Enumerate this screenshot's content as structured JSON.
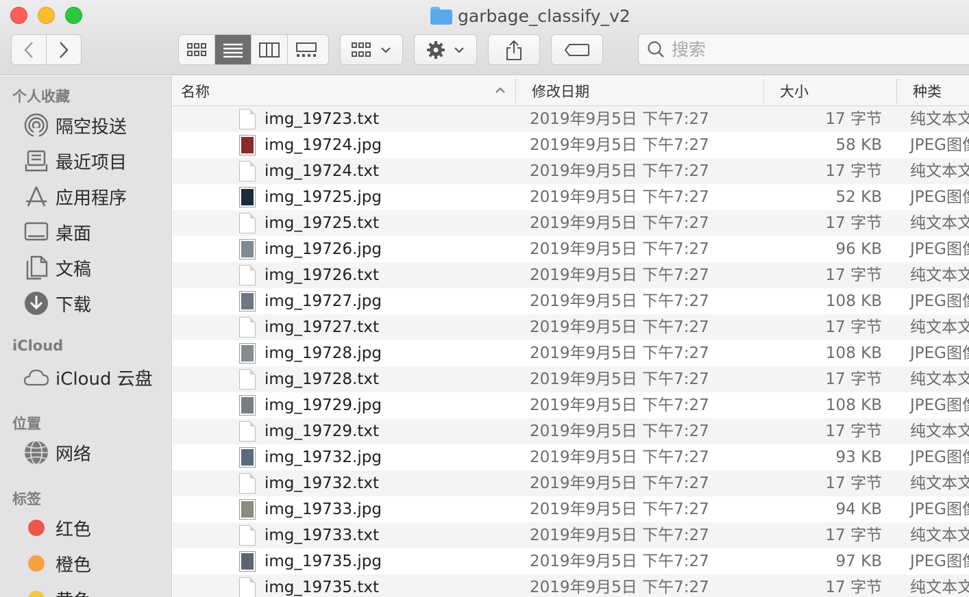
{
  "window": {
    "title": "garbage_classify_v2"
  },
  "toolbar": {
    "search_placeholder": "搜索"
  },
  "sidebar": {
    "sections": [
      {
        "title": "个人收藏",
        "items": [
          {
            "label": "隔空投送",
            "icon": "airdrop-icon"
          },
          {
            "label": "最近项目",
            "icon": "recents-icon"
          },
          {
            "label": "应用程序",
            "icon": "applications-icon"
          },
          {
            "label": "桌面",
            "icon": "desktop-icon"
          },
          {
            "label": "文稿",
            "icon": "documents-icon"
          },
          {
            "label": "下载",
            "icon": "downloads-icon"
          }
        ]
      },
      {
        "title": "iCloud",
        "items": [
          {
            "label": "iCloud 云盘",
            "icon": "icloud-icon"
          }
        ]
      },
      {
        "title": "位置",
        "items": [
          {
            "label": "网络",
            "icon": "network-icon"
          }
        ]
      },
      {
        "title": "标签",
        "items": [
          {
            "label": "红色",
            "color": "#f0554f"
          },
          {
            "label": "橙色",
            "color": "#f5a243"
          },
          {
            "label": "黄色",
            "color": "#f3c93e"
          }
        ]
      }
    ]
  },
  "columns": {
    "name": "名称",
    "date": "修改日期",
    "size": "大小",
    "kind": "种类"
  },
  "files": [
    {
      "name": "img_19723.txt",
      "date": "2019年9月5日 下午7:27",
      "size": "17 字节",
      "kind": "纯文本文稿",
      "type": "txt"
    },
    {
      "name": "img_19724.jpg",
      "date": "2019年9月5日 下午7:27",
      "size": "58 KB",
      "kind": "JPEG图像",
      "type": "jpg",
      "tint": "#8b2a2a"
    },
    {
      "name": "img_19724.txt",
      "date": "2019年9月5日 下午7:27",
      "size": "17 字节",
      "kind": "纯文本文稿",
      "type": "txt"
    },
    {
      "name": "img_19725.jpg",
      "date": "2019年9月5日 下午7:27",
      "size": "52 KB",
      "kind": "JPEG图像",
      "type": "jpg",
      "tint": "#1e2a3a"
    },
    {
      "name": "img_19725.txt",
      "date": "2019年9月5日 下午7:27",
      "size": "17 字节",
      "kind": "纯文本文稿",
      "type": "txt"
    },
    {
      "name": "img_19726.jpg",
      "date": "2019年9月5日 下午7:27",
      "size": "96 KB",
      "kind": "JPEG图像",
      "type": "jpg",
      "tint": "#7f8a94"
    },
    {
      "name": "img_19726.txt",
      "date": "2019年9月5日 下午7:27",
      "size": "17 字节",
      "kind": "纯文本文稿",
      "type": "txt"
    },
    {
      "name": "img_19727.jpg",
      "date": "2019年9月5日 下午7:27",
      "size": "108 KB",
      "kind": "JPEG图像",
      "type": "jpg",
      "tint": "#6f7780"
    },
    {
      "name": "img_19727.txt",
      "date": "2019年9月5日 下午7:27",
      "size": "17 字节",
      "kind": "纯文本文稿",
      "type": "txt"
    },
    {
      "name": "img_19728.jpg",
      "date": "2019年9月5日 下午7:27",
      "size": "108 KB",
      "kind": "JPEG图像",
      "type": "jpg",
      "tint": "#868b8f"
    },
    {
      "name": "img_19728.txt",
      "date": "2019年9月5日 下午7:27",
      "size": "17 字节",
      "kind": "纯文本文稿",
      "type": "txt"
    },
    {
      "name": "img_19729.jpg",
      "date": "2019年9月5日 下午7:27",
      "size": "108 KB",
      "kind": "JPEG图像",
      "type": "jpg",
      "tint": "#7a7e84"
    },
    {
      "name": "img_19729.txt",
      "date": "2019年9月5日 下午7:27",
      "size": "17 字节",
      "kind": "纯文本文稿",
      "type": "txt"
    },
    {
      "name": "img_19732.jpg",
      "date": "2019年9月5日 下午7:27",
      "size": "93 KB",
      "kind": "JPEG图像",
      "type": "jpg",
      "tint": "#5c6a7c"
    },
    {
      "name": "img_19732.txt",
      "date": "2019年9月5日 下午7:27",
      "size": "17 字节",
      "kind": "纯文本文稿",
      "type": "txt"
    },
    {
      "name": "img_19733.jpg",
      "date": "2019年9月5日 下午7:27",
      "size": "94 KB",
      "kind": "JPEG图像",
      "type": "jpg",
      "tint": "#8a8c7e"
    },
    {
      "name": "img_19733.txt",
      "date": "2019年9月5日 下午7:27",
      "size": "17 字节",
      "kind": "纯文本文稿",
      "type": "txt"
    },
    {
      "name": "img_19735.jpg",
      "date": "2019年9月5日 下午7:27",
      "size": "97 KB",
      "kind": "JPEG图像",
      "type": "jpg",
      "tint": "#5d6570"
    },
    {
      "name": "img_19735.txt",
      "date": "2019年9月5日 下午7:27",
      "size": "17 字节",
      "kind": "纯文本文稿",
      "type": "txt"
    }
  ]
}
